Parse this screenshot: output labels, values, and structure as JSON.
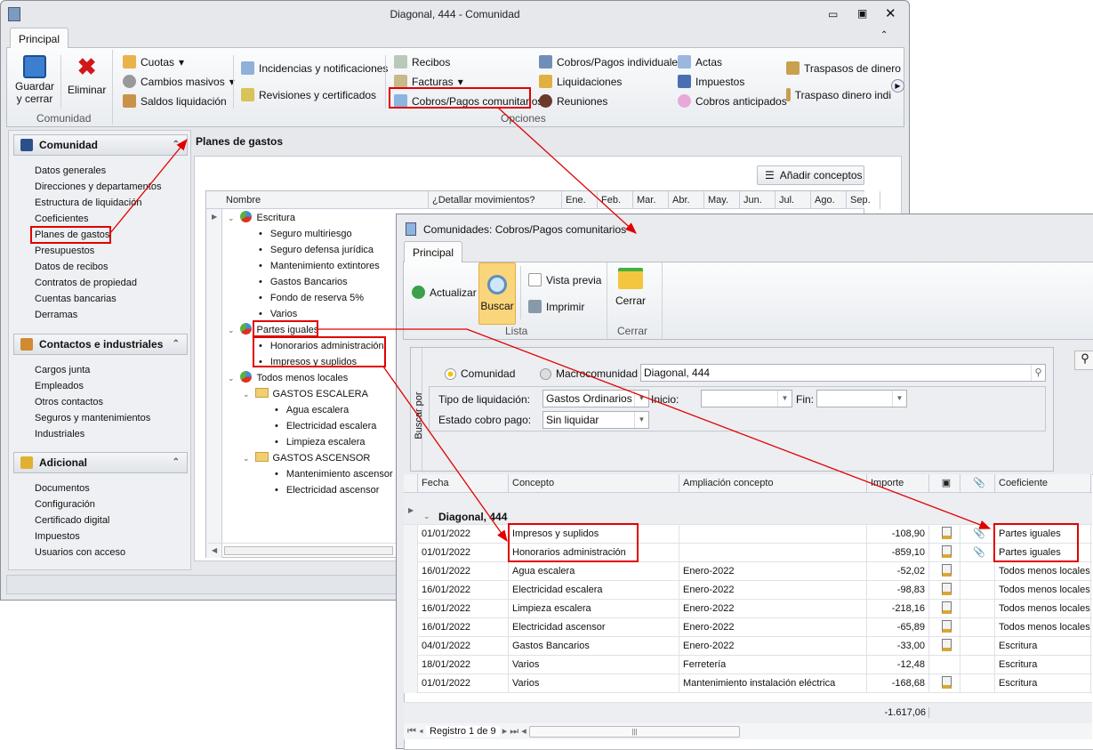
{
  "main_window": {
    "title": "Diagonal, 444 - Comunidad",
    "tab": "Principal",
    "ribbon": {
      "save": "Guardar y cerrar",
      "delete": "Eliminar",
      "group_comunidad": "Comunidad",
      "cuotas": "Cuotas",
      "cambios": "Cambios masivos",
      "saldos": "Saldos liquidación",
      "incidencias": "Incidencias y notificaciones",
      "revisiones": "Revisiones y certificados",
      "recibos": "Recibos",
      "facturas": "Facturas",
      "cobros_com": "Cobros/Pagos comunitarios",
      "cobros_ind": "Cobros/Pagos individuales",
      "liquidaciones": "Liquidaciones",
      "reuniones": "Reuniones",
      "actas": "Actas",
      "impuestos": "Impuestos",
      "anticipados": "Cobros anticipados",
      "traspasos": "Traspasos de dinero",
      "traspaso_ind": "Traspaso dinero indi",
      "group_opciones": "Opciones"
    },
    "sidebar": {
      "groups": [
        {
          "title": "Comunidad",
          "items": [
            "Datos generales",
            "Direcciones y departamentos",
            "Estructura de liquidación",
            "Coeficientes",
            "Planes de gastos",
            "Presupuestos",
            "Datos de recibos",
            "Contratos de propiedad",
            "Cuentas bancarias",
            "Derramas"
          ]
        },
        {
          "title": "Contactos e industriales",
          "items": [
            "Cargos junta",
            "Empleados",
            "Otros contactos",
            "Seguros y mantenimientos",
            "Industriales"
          ]
        },
        {
          "title": "Adicional",
          "items": [
            "Documentos",
            "Configuración",
            "Certificado digital",
            "Impuestos",
            "Usuarios con acceso"
          ]
        }
      ]
    },
    "panel": {
      "title": "Planes de gastos",
      "add_button": "Añadir conceptos",
      "columns": [
        "Nombre",
        "¿Detallar movimientos?",
        "Ene.",
        "Feb.",
        "Mar.",
        "Abr.",
        "May.",
        "Jun.",
        "Jul.",
        "Ago.",
        "Sep."
      ],
      "tree": [
        {
          "label": "Escritura",
          "level": 0,
          "type": "pie"
        },
        {
          "label": "Seguro multiriesgo",
          "level": 1,
          "type": "bullet"
        },
        {
          "label": "Seguro defensa jurídica",
          "level": 1,
          "type": "bullet"
        },
        {
          "label": "Mantenimiento extintores",
          "level": 1,
          "type": "bullet"
        },
        {
          "label": "Gastos Bancarios",
          "level": 1,
          "type": "bullet"
        },
        {
          "label": "Fondo de reserva 5%",
          "level": 1,
          "type": "bullet"
        },
        {
          "label": "Varios",
          "level": 1,
          "type": "bullet"
        },
        {
          "label": "Partes iguales",
          "level": 0,
          "type": "pie"
        },
        {
          "label": "Honorarios administración",
          "level": 1,
          "type": "bullet"
        },
        {
          "label": "Impresos y suplidos",
          "level": 1,
          "type": "bullet"
        },
        {
          "label": "Todos menos locales",
          "level": 0,
          "type": "pie"
        },
        {
          "label": "GASTOS ESCALERA",
          "level": 1,
          "type": "folder"
        },
        {
          "label": "Agua escalera",
          "level": 2,
          "type": "bullet"
        },
        {
          "label": "Electricidad escalera",
          "level": 2,
          "type": "bullet"
        },
        {
          "label": "Limpieza escalera",
          "level": 2,
          "type": "bullet"
        },
        {
          "label": "GASTOS ASCENSOR",
          "level": 1,
          "type": "folder"
        },
        {
          "label": "Mantenimiento ascensor",
          "level": 2,
          "type": "bullet"
        },
        {
          "label": "Electricidad ascensor",
          "level": 2,
          "type": "bullet"
        }
      ]
    }
  },
  "sub_window": {
    "title": "Comunidades: Cobros/Pagos comunitarios",
    "tab": "Principal",
    "ribbon": {
      "actualizar": "Actualizar",
      "buscar": "Buscar",
      "vista": "Vista previa",
      "imprimir": "Imprimir",
      "group_lista": "Lista",
      "cerrar": "Cerrar",
      "group_cerrar": "Cerrar"
    },
    "filter": {
      "side_label": "Buscar por",
      "radio_comunidad": "Comunidad",
      "radio_macro": "Macrocomunidad",
      "comunidad_value": "Diagonal, 444",
      "tipo_label": "Tipo de liquidación:",
      "tipo_value": "Gastos Ordinarios",
      "inicio_label": "Inicio:",
      "fin_label": "Fin:",
      "estado_label": "Estado cobro pago:",
      "estado_value": "Sin liquidar"
    },
    "grid": {
      "columns": [
        "Fecha",
        "Concepto",
        "Ampliación concepto",
        "Importe",
        "Coeficiente"
      ],
      "group": "Diagonal, 444",
      "rows": [
        {
          "fecha": "01/01/2022",
          "concepto": "Impresos y suplidos",
          "ampliacion": "",
          "importe": "-108,90",
          "doc": true,
          "clip": true,
          "coef": "Partes iguales"
        },
        {
          "fecha": "01/01/2022",
          "concepto": "Honorarios administración",
          "ampliacion": "",
          "importe": "-859,10",
          "doc": true,
          "clip": true,
          "coef": "Partes iguales"
        },
        {
          "fecha": "16/01/2022",
          "concepto": "Agua escalera",
          "ampliacion": "Enero-2022",
          "importe": "-52,02",
          "doc": true,
          "clip": false,
          "coef": "Todos menos locales"
        },
        {
          "fecha": "16/01/2022",
          "concepto": "Electricidad escalera",
          "ampliacion": "Enero-2022",
          "importe": "-98,83",
          "doc": true,
          "clip": false,
          "coef": "Todos menos locales"
        },
        {
          "fecha": "16/01/2022",
          "concepto": "Limpieza escalera",
          "ampliacion": "Enero-2022",
          "importe": "-218,16",
          "doc": true,
          "clip": false,
          "coef": "Todos menos locales"
        },
        {
          "fecha": "16/01/2022",
          "concepto": "Electricidad ascensor",
          "ampliacion": "Enero-2022",
          "importe": "-65,89",
          "doc": true,
          "clip": false,
          "coef": "Todos menos locales"
        },
        {
          "fecha": "04/01/2022",
          "concepto": "Gastos Bancarios",
          "ampliacion": "Enero-2022",
          "importe": "-33,00",
          "doc": true,
          "clip": false,
          "coef": "Escritura"
        },
        {
          "fecha": "18/01/2022",
          "concepto": "Varios",
          "ampliacion": "Ferretería",
          "importe": "-12,48",
          "doc": false,
          "clip": false,
          "coef": "Escritura"
        },
        {
          "fecha": "01/01/2022",
          "concepto": "Varios",
          "ampliacion": "Mantenimiento instalación eléctrica",
          "importe": "-168,68",
          "doc": true,
          "clip": false,
          "coef": "Escritura"
        }
      ],
      "total": "-1.617,06",
      "nav": "Registro 1 de 9"
    }
  },
  "colors": {
    "annotation": "#e00000",
    "selected_button": "#fbd57a"
  }
}
